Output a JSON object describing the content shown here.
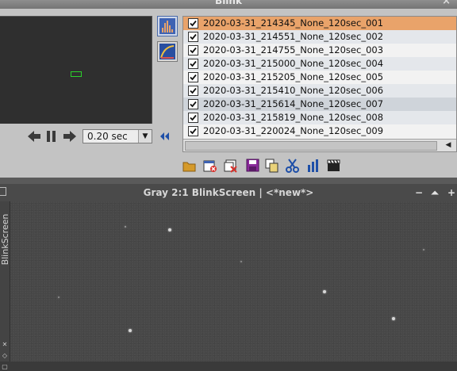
{
  "blink": {
    "title": "Blink",
    "close_glyph": "×",
    "tools": [
      {
        "icon": "histogram-icon",
        "active": true
      },
      {
        "icon": "stf-curve-icon",
        "active": false
      }
    ],
    "playback": {
      "prev_icon": "arrow-left-icon",
      "pause_icon": "pause-icon",
      "next_icon": "arrow-right-icon",
      "speed": "0.20 sec",
      "rewind_icon": "rewind-icon"
    },
    "files": [
      {
        "name": "2020-03-31_214345_None_120sec_001",
        "checked": true,
        "selected": true
      },
      {
        "name": "2020-03-31_214551_None_120sec_002",
        "checked": true
      },
      {
        "name": "2020-03-31_214755_None_120sec_003",
        "checked": true
      },
      {
        "name": "2020-03-31_215000_None_120sec_004",
        "checked": true
      },
      {
        "name": "2020-03-31_215205_None_120sec_005",
        "checked": true
      },
      {
        "name": "2020-03-31_215410_None_120sec_006",
        "checked": true
      },
      {
        "name": "2020-03-31_215614_None_120sec_007",
        "checked": true
      },
      {
        "name": "2020-03-31_215819_None_120sec_008",
        "checked": true
      },
      {
        "name": "2020-03-31_220024_None_120sec_009",
        "checked": true
      }
    ],
    "toolbar": [
      "open-folder-icon",
      "close-file-icon",
      "close-all-icon",
      "save-icon",
      "copy-icon",
      "crop-icon",
      "statistics-icon",
      "movie-icon"
    ]
  },
  "image_window": {
    "title": "Gray 2:1 BlinkScreen | <*new*>",
    "side_tab_label": "BlinkScreen",
    "controls": {
      "minimize": "−",
      "shade": "⏶",
      "maximize": "+"
    }
  },
  "colors": {
    "panel_bg": "#c3c3c3",
    "selected_row": "#e9a36a",
    "accent_blue": "#1e4fa8",
    "preview_marker": "#2bd12b"
  }
}
